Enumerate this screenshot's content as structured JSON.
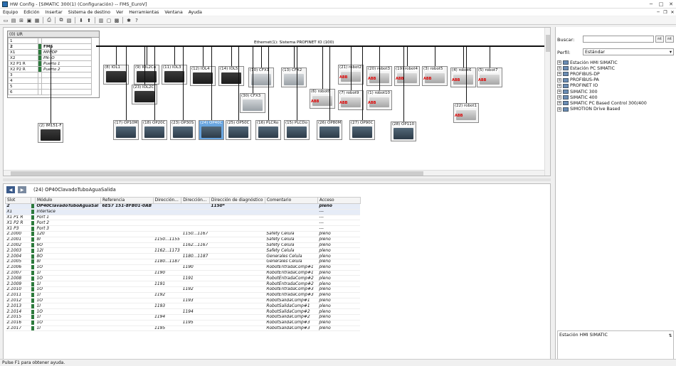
{
  "window": {
    "title": "HW Config - [SIMATIC 300(1) (Configuración) -- FMS_EuroV]",
    "min": "─",
    "max": "□",
    "close": "✕"
  },
  "menu": [
    "Equipo",
    "Edición",
    "Insertar",
    "Sistema de destino",
    "Ver",
    "Herramientas",
    "Ventana",
    "Ayuda"
  ],
  "rack": {
    "title": "(0) UR",
    "rows": [
      {
        "slot": "1",
        "mod": ""
      },
      {
        "slot": "2",
        "mod": "FMS",
        "bold": true
      },
      {
        "slot": "X1",
        "mod": "MPI/DP",
        "it": true
      },
      {
        "slot": "X2",
        "mod": "PN-IO",
        "it": true
      },
      {
        "slot": "X2 P1 R",
        "mod": "Puerto 1",
        "it": true
      },
      {
        "slot": "X2 P2 R",
        "mod": "Puerto 2",
        "it": true
      },
      {
        "slot": "3",
        "mod": ""
      },
      {
        "slot": "4",
        "mod": ""
      },
      {
        "slot": "5",
        "mod": ""
      },
      {
        "slot": "6",
        "mod": ""
      }
    ]
  },
  "bus_label": "Ethernet(1): Sistema PROFINET IO (100)",
  "devices": [
    {
      "id": "d1",
      "label": "(8) IOL1",
      "type": "io"
    },
    {
      "id": "d2",
      "label": "(9) IOL2Co",
      "type": "io"
    },
    {
      "id": "d3",
      "label": "(11) IOL3",
      "type": "io"
    },
    {
      "id": "d4",
      "label": "(12) IOL4",
      "type": "io"
    },
    {
      "id": "d5",
      "label": "(14) IOL5",
      "type": "io"
    },
    {
      "id": "d6",
      "label": "(10) CFX1",
      "type": "cpx"
    },
    {
      "id": "d7",
      "label": "(13) CFX2",
      "type": "cpx"
    },
    {
      "id": "d8",
      "label": "(21) robot2",
      "type": "robot"
    },
    {
      "id": "d9",
      "label": "(20) robot3",
      "type": "robot"
    },
    {
      "id": "d10",
      "label": "(19) robot4",
      "type": "robot"
    },
    {
      "id": "d11",
      "label": "(3) robot5",
      "type": "robot"
    },
    {
      "id": "d12",
      "label": "(4) robot6",
      "type": "robot"
    },
    {
      "id": "d13",
      "label": "(5) robot7",
      "type": "robot"
    },
    {
      "id": "d14",
      "label": "(23) IOL2C",
      "type": "io"
    },
    {
      "id": "d15",
      "label": "(30) CFX3",
      "type": "cpx"
    },
    {
      "id": "d16",
      "label": "(6) robot8",
      "type": "robot"
    },
    {
      "id": "d17",
      "label": "(7) robot9",
      "type": "robot"
    },
    {
      "id": "d18",
      "label": "(1) robot10",
      "type": "robot"
    },
    {
      "id": "d19",
      "label": "(22) robot1",
      "type": "robot"
    },
    {
      "id": "d20",
      "label": "(2) IM151-F",
      "type": "io"
    },
    {
      "id": "d21",
      "label": "(17) OP10M",
      "type": "panel"
    },
    {
      "id": "d22",
      "label": "(18) OP20C",
      "type": "panel"
    },
    {
      "id": "d23",
      "label": "(23) OP30S",
      "type": "panel"
    },
    {
      "id": "d24",
      "label": "(24) OP40C",
      "type": "panel",
      "selected": true
    },
    {
      "id": "d25",
      "label": "(25) OP50C",
      "type": "panel"
    },
    {
      "id": "d26",
      "label": "(16) PLCRo",
      "type": "panel"
    },
    {
      "id": "d27",
      "label": "(15) PLCDo",
      "type": "panel"
    },
    {
      "id": "d28",
      "label": "(26) OP80M",
      "type": "panel"
    },
    {
      "id": "d29",
      "label": "(27) OP90C",
      "type": "panel"
    },
    {
      "id": "d30",
      "label": "(28) OP110",
      "type": "panel"
    }
  ],
  "lower": {
    "title": "(24)   OP40ClavadoTuboAguaSalida",
    "columns": [
      "Slot",
      "",
      "Módulo",
      "Referencia",
      "Dirección...",
      "Dirección...",
      "Dirección de diagnóstico",
      "Comentario",
      "Acceso"
    ],
    "rows": [
      [
        "2",
        "OP40ClavadoTuboAguaSal",
        "6ES7 151-8FB01-0AB",
        "",
        "",
        "1150*",
        "",
        "pleno"
      ],
      [
        "X1",
        "Interface",
        "",
        "",
        "",
        "",
        "",
        "---"
      ],
      [
        "X1 P1 R",
        "Port 1",
        "",
        "",
        "",
        "",
        "",
        "---"
      ],
      [
        "X1 P2 R",
        "Port 2",
        "",
        "",
        "",
        "",
        "",
        "---"
      ],
      [
        "X1 P3",
        "Port 3",
        "",
        "",
        "",
        "",
        "",
        "---"
      ],
      [
        "2.1000",
        "120",
        "",
        "",
        "1150...1167",
        "",
        "Safety Celula",
        "pleno"
      ],
      [
        "2.1001",
        "8I",
        "",
        "1150...1155",
        "",
        "",
        "Safety Celula",
        "pleno"
      ],
      [
        "2.1002",
        "6O",
        "",
        "",
        "1162...1167",
        "",
        "Safety Celula",
        "pleno"
      ],
      [
        "2.1003",
        "12I",
        "",
        "1162...1173",
        "",
        "",
        "Safety Celula",
        "pleno"
      ],
      [
        "2.1004",
        "8O",
        "",
        "",
        "1180...1187",
        "",
        "Generales Celula",
        "pleno"
      ],
      [
        "2.1005",
        "8I",
        "",
        "1180...1187",
        "",
        "",
        "Generales Celula",
        "pleno"
      ],
      [
        "2.1006",
        "1O",
        "",
        "",
        "1190",
        "",
        "RobotEntradaComp#1",
        "pleno"
      ],
      [
        "2.1007",
        "1I",
        "",
        "1190",
        "",
        "",
        "RobotEntradaComp#1",
        "pleno"
      ],
      [
        "2.1008",
        "1O",
        "",
        "",
        "1191",
        "",
        "RobotEntradaComp#2",
        "pleno"
      ],
      [
        "2.1009",
        "1I",
        "",
        "1191",
        "",
        "",
        "RobotEntradaComp#2",
        "pleno"
      ],
      [
        "2.1010",
        "1O",
        "",
        "",
        "1192",
        "",
        "RobotEntradaComp#3",
        "pleno"
      ],
      [
        "2.1011",
        "1I",
        "",
        "1192",
        "",
        "",
        "RobotEntradaComp#3",
        "pleno"
      ],
      [
        "2.1012",
        "1O",
        "",
        "",
        "1193",
        "",
        "RobotSalidaComp#1",
        "pleno"
      ],
      [
        "2.1013",
        "1I",
        "",
        "1193",
        "",
        "",
        "RobotSalidaComp#1",
        "pleno"
      ],
      [
        "2.1014",
        "1O",
        "",
        "",
        "1194",
        "",
        "RobotSalidaComp#2",
        "pleno"
      ],
      [
        "2.1015",
        "1I",
        "",
        "1194",
        "",
        "",
        "RobotSalidaComp#2",
        "pleno"
      ],
      [
        "2.1016",
        "1O",
        "",
        "",
        "1195",
        "",
        "RobotSalidaComp#3",
        "pleno"
      ],
      [
        "2.1017",
        "1I",
        "",
        "1195",
        "",
        "",
        "RobotSalidaComp#3",
        "pleno"
      ]
    ]
  },
  "right": {
    "search_label": "Buscar:",
    "search_value": "",
    "profile_label": "Perfil:",
    "profile_value": "Estándar",
    "tree": [
      "Estación HMI SIMATIC",
      "Estación PC SIMATIC",
      "PROFIBUS-DP",
      "PROFIBUS-PA",
      "PROFINET IO",
      "SIMATIC 300",
      "SIMATIC 400",
      "SIMATIC PC Based Control 300/400",
      "SIMOTION Drive Based"
    ],
    "info": "Estación HMI SIMATIC"
  },
  "status": "Pulse F1 para obtener ayuda."
}
